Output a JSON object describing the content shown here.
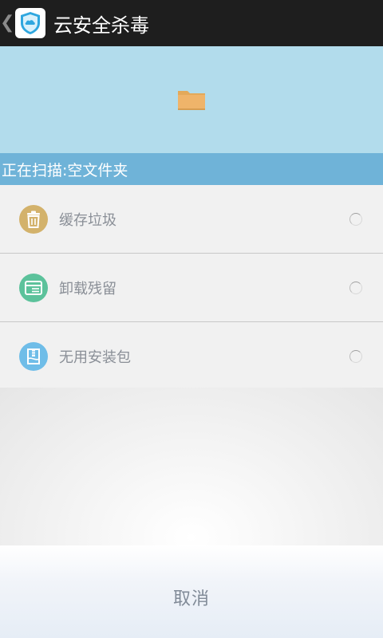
{
  "header": {
    "back_icon": "chevron-left-icon",
    "app_icon": "shield-cloud-icon",
    "title": "云安全杀毒"
  },
  "scan": {
    "folder_icon": "folder-icon",
    "status_text": "正在扫描:空文件夹"
  },
  "items": [
    {
      "label": "缓存垃圾",
      "icon": "trash-icon",
      "color": "#d3b26b"
    },
    {
      "label": "卸载残留",
      "icon": "card-icon",
      "color": "#5cc29b"
    },
    {
      "label": "无用安装包",
      "icon": "package-icon",
      "color": "#6fbde8"
    }
  ],
  "colors": {
    "hero_bg": "#b2dcec",
    "scan_bar_bg": "#6fb3d8",
    "topbar_bg": "#1e1e1e"
  },
  "footer": {
    "cancel_label": "取消"
  }
}
